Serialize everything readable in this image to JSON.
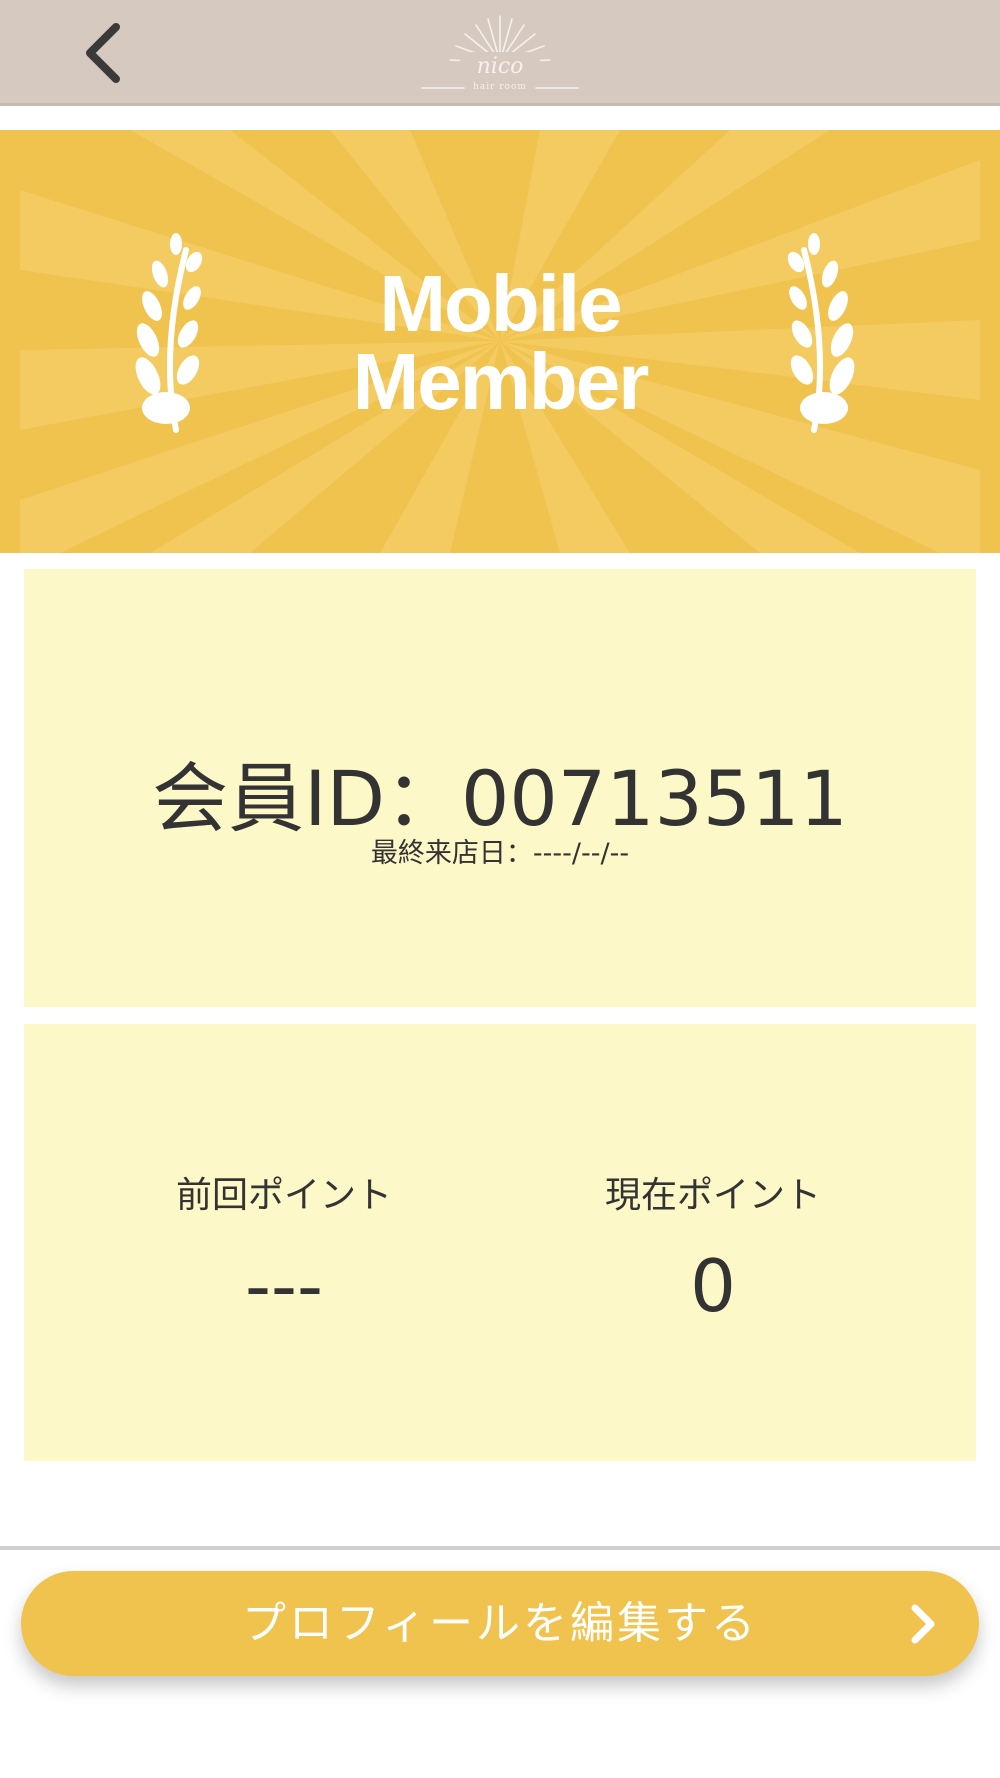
{
  "header": {
    "back_icon": "chevron-left-icon",
    "logo_text": "nico",
    "logo_subtext": "hair room"
  },
  "banner": {
    "title_line1": "Mobile",
    "title_line2": "Member",
    "left_icon": "laurel-branch-icon",
    "right_icon": "laurel-branch-icon"
  },
  "member": {
    "id_label": "会員ID：",
    "id_value": "00713511",
    "last_visit_label": "最終来店日：",
    "last_visit_value": "----/--/--"
  },
  "points": {
    "previous_label": "前回ポイント",
    "previous_value": "---",
    "current_label": "現在ポイント",
    "current_value": "0"
  },
  "footer": {
    "edit_profile_label": "プロフィールを編集する",
    "edit_profile_icon": "chevron-right-icon"
  },
  "colors": {
    "header_bg": "#d6c9c0",
    "accent": "#f0c24e",
    "card_bg": "#fdf8c8",
    "text": "#333333"
  }
}
